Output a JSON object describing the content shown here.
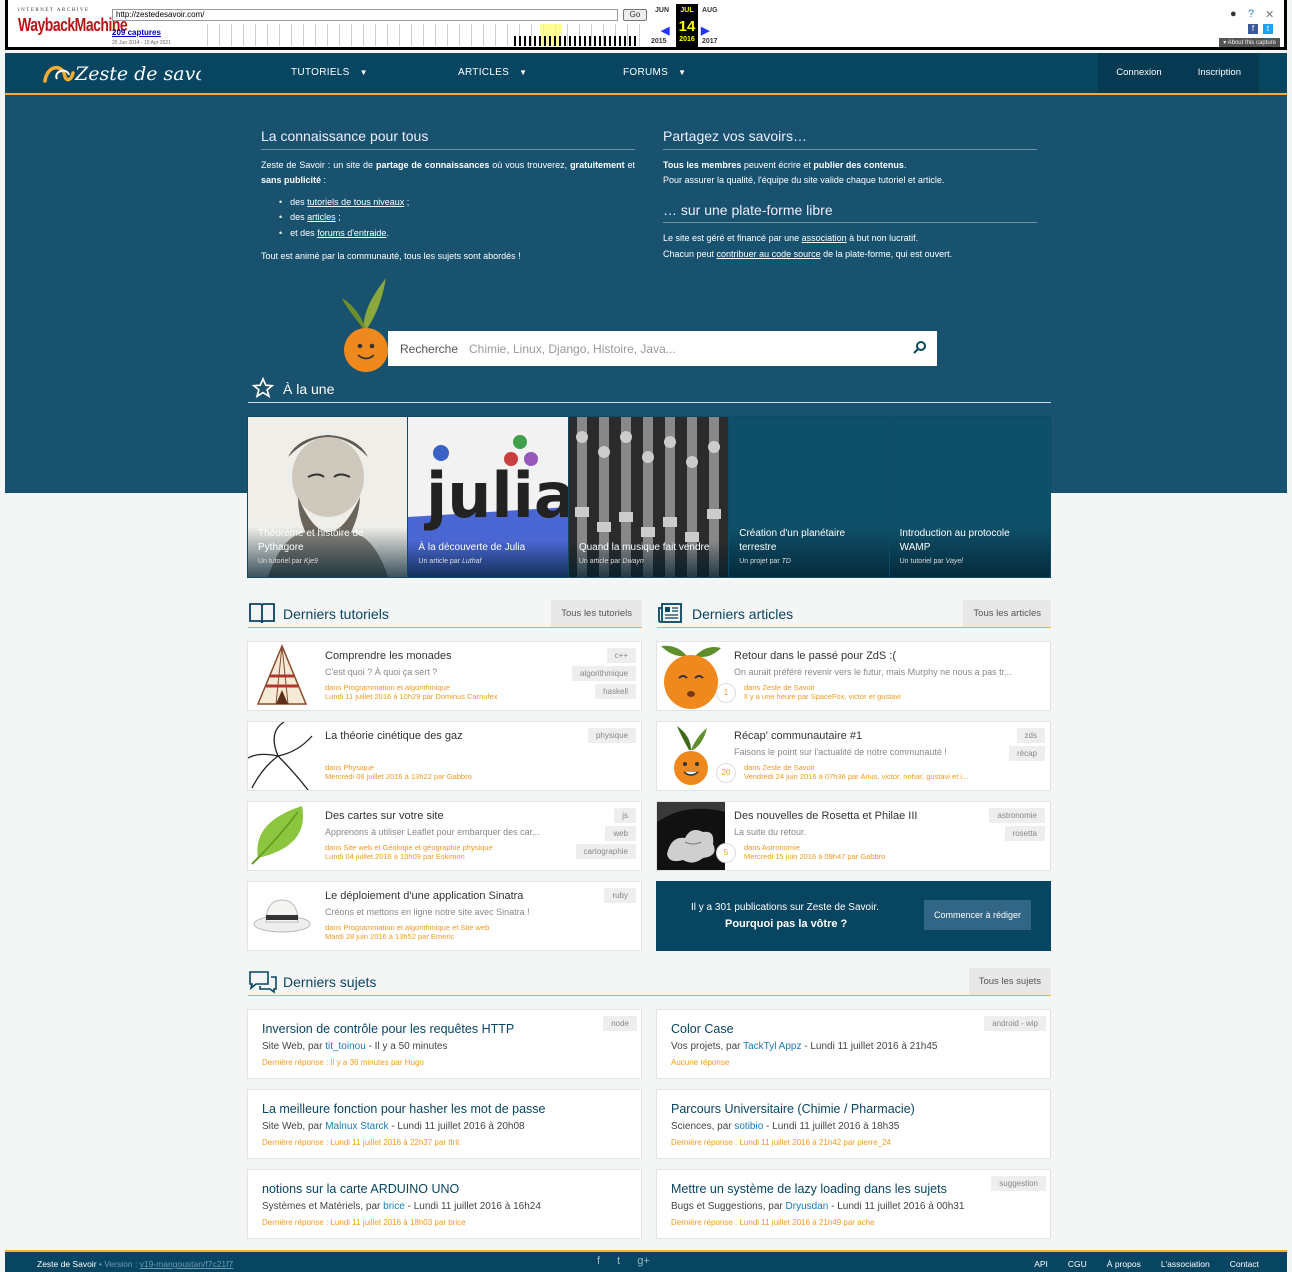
{
  "wayback": {
    "logo_top": "INTERNET ARCHIVE",
    "logo_main": "WaybackMachine",
    "url": "http://zestedesavoir.com/",
    "go": "Go",
    "captures": "209 captures",
    "range": "25 Jun 2014 - 15 Apr 2021",
    "prev_month": "JUN",
    "cur_month": "JUL",
    "next_month": "AUG",
    "day": "14",
    "prev_year": "2015",
    "cur_year": "2016",
    "next_year": "2017",
    "about": "About this capture"
  },
  "header": {
    "brand": "Zeste de savoir",
    "nav": [
      "TUTORIELS",
      "ARTICLES",
      "FORUMS"
    ],
    "login": "Connexion",
    "signup": "Inscription"
  },
  "hero": {
    "left_title": "La connaissance pour tous",
    "left_p1_a": "Zeste de Savoir : un site de ",
    "left_p1_b": "partage de connaissances",
    "left_p1_c": " où vous trouverez, ",
    "left_p1_d": "gratuitement",
    "left_p1_e": " et ",
    "left_p1_f": "sans publicité",
    "left_p1_g": " :",
    "li1_a": "des ",
    "li1_link": "tutoriels de tous niveaux",
    "li1_b": " ;",
    "li2_a": "des ",
    "li2_link": "articles",
    "li2_b": " ;",
    "li3_a": "et des ",
    "li3_link": "forums d'entraide",
    "li3_b": ".",
    "left_p2": "Tout est animé par la communauté, tous les sujets sont abordés !",
    "right_title": "Partagez vos savoirs…",
    "right_p1_a": "Tous les membres",
    "right_p1_b": " peuvent écrire et ",
    "right_p1_c": "publier des contenus",
    "right_p1_d": ".",
    "right_p1_e": "Pour assurer la qualité, l'équipe du site valide chaque tutoriel et article.",
    "right_title2": "… sur une plate-forme libre",
    "right_p2_a": "Le site est géré et financé par une ",
    "right_p2_link": "association",
    "right_p2_b": " à but non lucratif.",
    "right_p2_c": "Chacun peut ",
    "right_p2_link2": "contribuer au code source",
    "right_p2_d": " de la plate-forme, qui est ouvert."
  },
  "search": {
    "label": "Recherche",
    "placeholder": "Chimie, Linux, Django, Histoire, Java..."
  },
  "une": {
    "title": "À la une",
    "items": [
      {
        "title": "Théorème et histoire de Pythagore",
        "sub": "Un tutoriel par",
        "author": "Kje9"
      },
      {
        "title": "À la découverte de Julia",
        "sub": "Un article par",
        "author": "Luthaf"
      },
      {
        "title": "Quand la musique fait vendre",
        "sub": "Un article par",
        "author": "Dwayn"
      },
      {
        "title": "Création d'un planétaire terrestre",
        "sub": "Un projet par",
        "author": "TD"
      },
      {
        "title": "Introduction au protocole WAMP",
        "sub": "Un tutoriel par",
        "author": "Vayel"
      }
    ],
    "julia_word": "julia"
  },
  "tutos": {
    "title": "Derniers tutoriels",
    "all": "Tous les tutoriels",
    "items": [
      {
        "title": "Comprendre les monades",
        "desc": "C'est quoi ? À quoi ça sert ?",
        "cat": "dans Programmation et algorithmique",
        "meta": "Lundi 11 juillet 2016 à 10h29 par Dominus Carnufex",
        "tags": [
          "c++",
          "algorithmique",
          "haskell"
        ]
      },
      {
        "title": "La théorie cinétique des gaz",
        "desc": "",
        "cat": "dans Physique",
        "meta": "Mercredi 06 juillet 2016 à 13h22 par Gabbro",
        "tags": [
          "physique"
        ]
      },
      {
        "title": "Des cartes sur votre site",
        "desc": "Apprenons à utiliser Leaflet pour embarquer des car...",
        "cat": "dans Site web et Géologie et géographie physique",
        "meta": "Lundi 04 juillet 2016 à 10h09 par Eskimon",
        "tags": [
          "js",
          "web",
          "cartographie"
        ]
      },
      {
        "title": "Le déploiement d'une application Sinatra",
        "desc": "Créons et mettons en ligne notre site avec Sinatra !",
        "cat": "dans Programmation et algorithmique et Site web",
        "meta": "Mardi 28 juin 2016 à 13h52 par Emeric",
        "tags": [
          "ruby"
        ]
      }
    ]
  },
  "articles": {
    "title": "Derniers articles",
    "all": "Tous les articles",
    "items": [
      {
        "title": "Retour dans le passé pour ZdS :(",
        "desc": "On aurait préféré revenir vers le futur, mais Murphy ne nous a pas tr...",
        "cat": "dans Zeste de Savoir",
        "meta": "Il y a une heure par SpaceFox, victor et gustavi",
        "count": "1",
        "tags": []
      },
      {
        "title": "Récap' communautaire #1",
        "desc": "Faisons le point sur l'actualité de notre communauté !",
        "cat": "dans Zeste de Savoir",
        "meta": "Vendredi 24 juin 2016 à 07h36 par Arius, victor, nohar, gustavi et i...",
        "count": "20",
        "tags": [
          "zds",
          "récap"
        ]
      },
      {
        "title": "Des nouvelles de Rosetta et Philae III",
        "desc": "La suite du retour.",
        "cat": "dans Astronomie",
        "meta": "Mercredi 15 juin 2016 à 09h47 par Gabbro",
        "count": "5",
        "tags": [
          "astronomie",
          "rosetta"
        ]
      }
    ],
    "cta_line1": "Il y a 301 publications sur Zeste de Savoir.",
    "cta_line2": "Pourquoi pas la vôtre ?",
    "cta_button": "Commencer à rédiger"
  },
  "topics": {
    "title": "Derniers sujets",
    "all": "Tous les sujets",
    "items": [
      {
        "title": "Inversion de contrôle pour les requêtes HTTP",
        "forum": "Site Web, par ",
        "user": "tit_toinou",
        "date": " - Il y a 50 minutes",
        "last": "Dernière réponse : Il y a 36 minutes par Hugo",
        "tag": "node"
      },
      {
        "title": "Color Case",
        "forum": "Vos projets, par ",
        "user": "TackTyl Appz",
        "date": " - Lundi 11 juillet 2016 à 21h45",
        "last": "Aucune réponse",
        "tag": "android - wip"
      },
      {
        "title": "La meilleure fonction pour hasher les mot de passe",
        "forum": "Site Web, par ",
        "user": "Malnux Starck",
        "date": " - Lundi 11 juillet 2016 à 20h08",
        "last": "Dernière réponse : Lundi 11 juillet 2016 à 22h37 par tfrit",
        "tag": ""
      },
      {
        "title": "Parcours Universitaire (Chimie / Pharmacie)",
        "forum": "Sciences, par ",
        "user": "sotibio",
        "date": " - Lundi 11 juillet 2016 à 18h35",
        "last": "Dernière réponse : Lundi 11 juillet 2016 à 21h42 par pierre_24",
        "tag": ""
      },
      {
        "title": "notions sur la carte ARDUINO UNO",
        "forum": "Systèmes et Matériels, par ",
        "user": "brice",
        "date": " - Lundi 11 juillet 2016 à 16h24",
        "last": "Dernière réponse : Lundi 11 juillet 2016 à 18h03 par brice",
        "tag": ""
      },
      {
        "title": "Mettre un système de lazy loading dans les sujets",
        "forum": "Bugs et Suggestions, par ",
        "user": "Dryusdan",
        "date": " - Lundi 11 juillet 2016 à 00h31",
        "last": "Dernière réponse : Lundi 11 juillet 2016 à 21h49 par ache",
        "tag": "suggestion"
      }
    ]
  },
  "footer": {
    "name": "Zeste de Savoir",
    "version_label": " • Version : ",
    "version": "v19-mangoustan/f7c21f7",
    "social": [
      "f",
      "t",
      "g+"
    ],
    "links": [
      "API",
      "CGU",
      "À propos",
      "L'association",
      "Contact"
    ]
  },
  "colors": {
    "primary": "#084561",
    "accent": "#f8ad32",
    "hero": "#19526f"
  }
}
